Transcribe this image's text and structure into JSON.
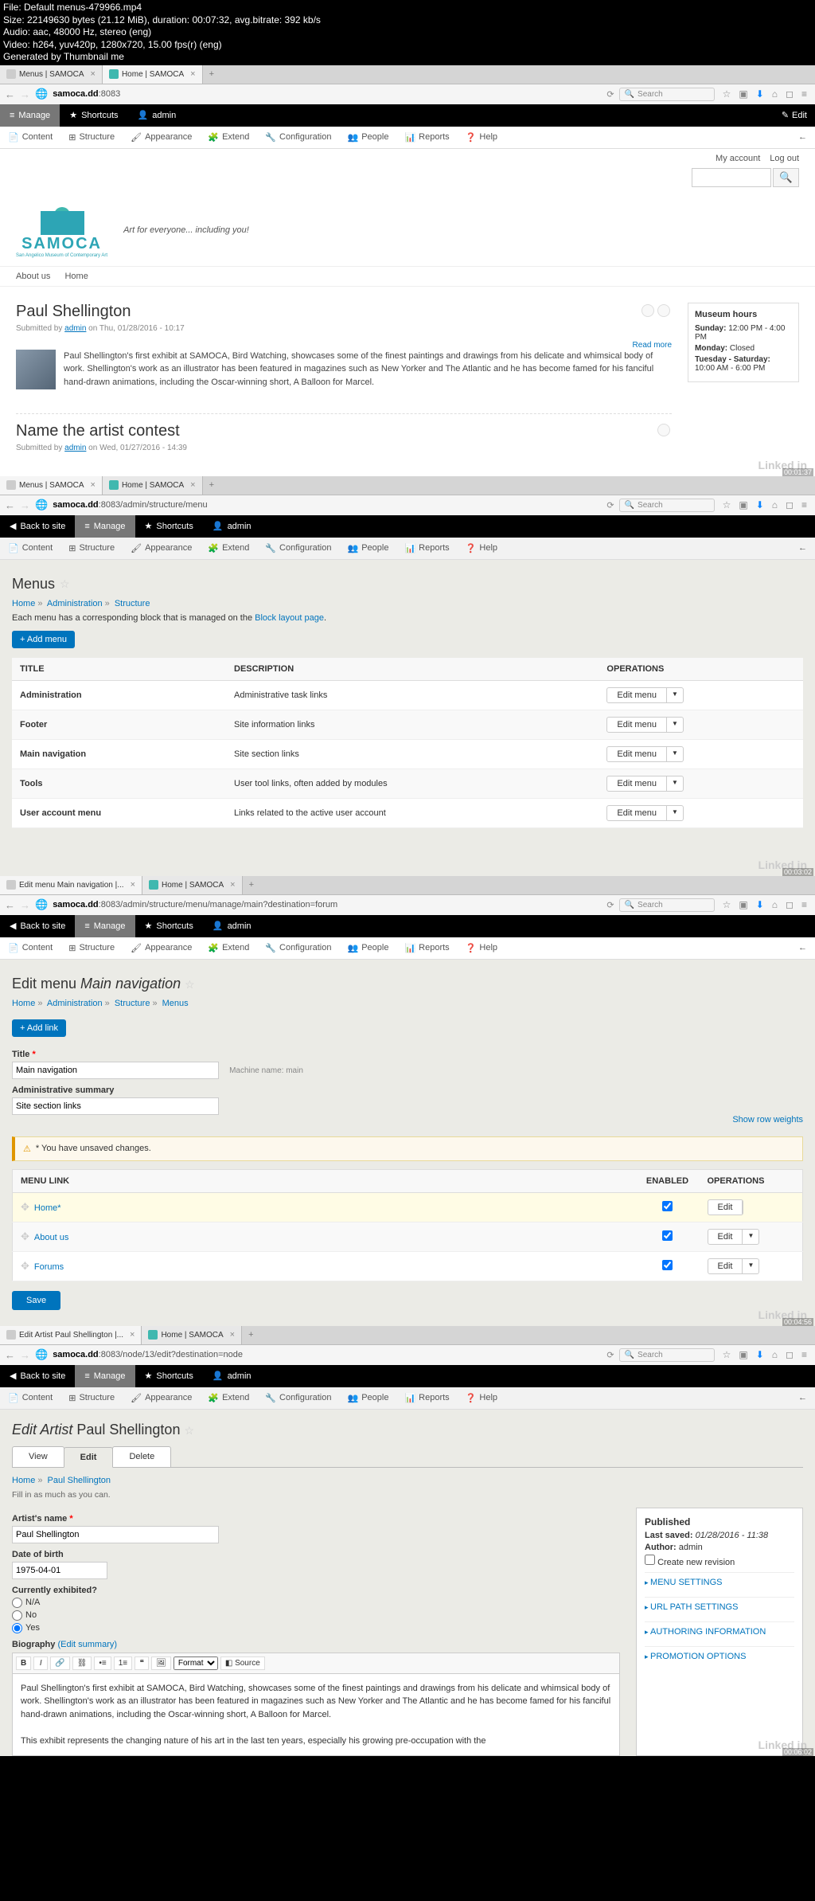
{
  "meta": {
    "line1": "File: Default menus-479966.mp4",
    "line2": "Size: 22149630 bytes (21.12 MiB), duration: 00:07:32, avg.bitrate: 392 kb/s",
    "line3": "Audio: aac, 48000 Hz, stereo (eng)",
    "line4": "Video: h264, yuv420p, 1280x720, 15.00 fps(r) (eng)",
    "line5": "Generated by Thumbnail me"
  },
  "browser": {
    "tab1": "Menus | SAMOCA",
    "tab1b": "Edit menu Main navigation |...",
    "tab1c": "Edit Artist Paul Shellington |...",
    "tab2": "Home | SAMOCA",
    "url1": "samoca.dd:8083",
    "url2": "samoca.dd:8083/admin/structure/menu",
    "url3": "samoca.dd:8083/admin/structure/menu/manage/main?destination=forum",
    "url4": "samoca.dd:8083/node/13/edit?destination=node",
    "search": "Search"
  },
  "toolbar": {
    "manage": "Manage",
    "backtosite": "Back to site",
    "shortcuts": "Shortcuts",
    "admin": "admin",
    "edit": "Edit",
    "content": "Content",
    "structure": "Structure",
    "appearance": "Appearance",
    "extend": "Extend",
    "configuration": "Configuration",
    "people": "People",
    "reports": "Reports",
    "help": "Help"
  },
  "p1": {
    "myaccount": "My account",
    "logout": "Log out",
    "logotext": "SAMOCA",
    "logosub": "San Angelico Museum of Contemporary Art",
    "slogan": "Art for everyone... including you!",
    "nav_about": "About us",
    "nav_home": "Home",
    "art1_title": "Paul Shellington",
    "art1_meta_pre": "Submitted by ",
    "art1_meta_auth": "admin",
    "art1_meta_post": " on Thu, 01/28/2016 - 10:17",
    "art1_body": "Paul Shellington's first exhibit at SAMOCA, Bird Watching, showcases some of the finest paintings and drawings from his delicate and whimsical body of work. Shellington's work as an illustrator has been featured in magazines such as New Yorker and The Atlantic and he has become famed for his fanciful hand-drawn animations, including the Oscar-winning short, A Balloon for Marcel.",
    "readmore": "Read more",
    "art2_title": "Name the artist contest",
    "art2_meta_pre": "Submitted by ",
    "art2_meta_auth": "admin",
    "art2_meta_post": " on Wed, 01/27/2016 - 14:39",
    "side_title": "Museum hours",
    "side_l1": "Sunday: 12:00 PM - 4:00 PM",
    "side_l2": "Monday: Closed",
    "side_l3": "Tuesday - Saturday: 10:00 AM - 6:00 PM",
    "ts": "00:01:37",
    "wm": "Linked in"
  },
  "p2": {
    "h1": "Menus",
    "crumb_home": "Home",
    "crumb_admin": "Administration",
    "crumb_struct": "Structure",
    "desc1": "Each menu has a corresponding block that is managed on the ",
    "desc2": "Block layout page",
    "addmenu": "+ Add menu",
    "th_title": "TITLE",
    "th_desc": "DESCRIPTION",
    "th_ops": "OPERATIONS",
    "rows": [
      {
        "t": "Administration",
        "d": "Administrative task links"
      },
      {
        "t": "Footer",
        "d": "Site information links"
      },
      {
        "t": "Main navigation",
        "d": "Site section links"
      },
      {
        "t": "Tools",
        "d": "User tool links, often added by modules"
      },
      {
        "t": "User account menu",
        "d": "Links related to the active user account"
      }
    ],
    "editmenu": "Edit menu",
    "ts": "00:03:02"
  },
  "p3": {
    "h1_pre": "Edit menu ",
    "h1_em": "Main navigation",
    "crumb_home": "Home",
    "crumb_admin": "Administration",
    "crumb_struct": "Structure",
    "crumb_menus": "Menus",
    "addlink": "+ Add link",
    "label_title": "Title",
    "val_title": "Main navigation",
    "machine": "Machine name: main",
    "label_summary": "Administrative summary",
    "val_summary": "Site section links",
    "warning": "* You have unsaved changes.",
    "showweights": "Show row weights",
    "th_link": "MENU LINK",
    "th_enabled": "ENABLED",
    "th_ops": "OPERATIONS",
    "r1": "Home*",
    "r2": "About us",
    "r3": "Forums",
    "edit": "Edit",
    "save": "Save",
    "ts": "00:04:56"
  },
  "p4": {
    "h1_pre": "Edit Artist ",
    "h1_name": "Paul Shellington",
    "crumb_home": "Home",
    "crumb_ps": "Paul Shellington",
    "tab_view": "View",
    "tab_edit": "Edit",
    "tab_delete": "Delete",
    "hint": "Fill in as much as you can.",
    "label_name": "Artist's name",
    "val_name": "Paul Shellington",
    "label_dob": "Date of birth",
    "val_dob": "1975-04-01",
    "label_exhib": "Currently exhibited?",
    "opt_na": "N/A",
    "opt_no": "No",
    "opt_yes": "Yes",
    "label_bio": "Biography",
    "edit_summary": "(Edit summary)",
    "w_format": "Format",
    "w_source": "Source",
    "bio_body": "Paul Shellington's first exhibit at SAMOCA, Bird Watching, showcases some of the finest paintings and drawings from his delicate and whimsical body of work. Shellington's work as an illustrator has been featured in magazines such as New Yorker and The Atlantic and he has become famed for his fanciful hand-drawn animations, including the Oscar-winning short, A Balloon for Marcel.",
    "bio_body2": "This exhibit represents the changing nature of his art in the last ten years, especially his growing pre-occupation with the",
    "pub_title": "Published",
    "pub_saved_l": "Last saved:",
    "pub_saved_v": "01/28/2016 - 11:38",
    "pub_auth_l": "Author:",
    "pub_auth_v": "admin",
    "pub_rev": "Create new revision",
    "det_menu": "MENU SETTINGS",
    "det_url": "URL PATH SETTINGS",
    "det_auth": "AUTHORING INFORMATION",
    "det_promo": "PROMOTION OPTIONS",
    "ts": "00:06:02"
  }
}
